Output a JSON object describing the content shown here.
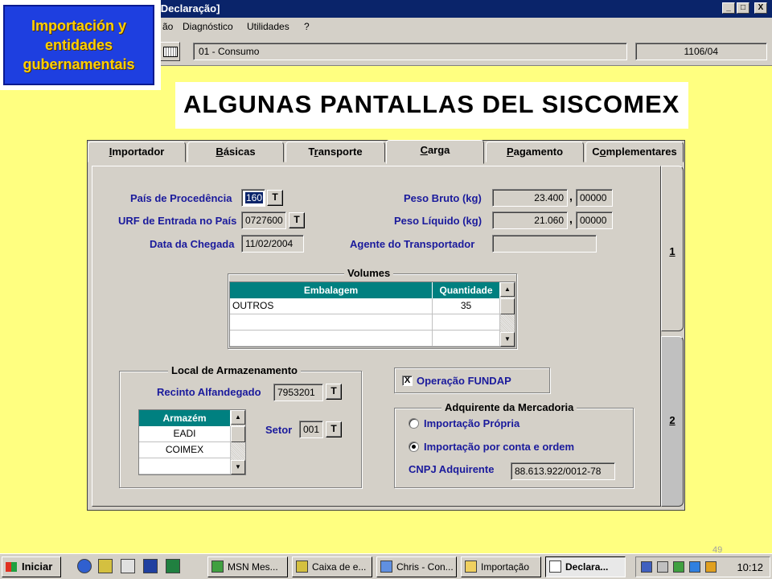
{
  "window": {
    "title": "Declaração de Importação - [Declaração]",
    "minimize": "_",
    "maximize": "□",
    "close": "X"
  },
  "menu": {
    "items": [
      "ão",
      "Diagnóstico",
      "Utilidades",
      "?"
    ]
  },
  "toolbar": {
    "type_value": "01 - Consumo",
    "number_value": "1106/04"
  },
  "logo": {
    "line1": "Importación y",
    "line2": "entidades",
    "line3": "gubernamentais"
  },
  "heading": "ALGUNAS PANTALLAS DEL SISCOMEX",
  "tabs": [
    "Importador",
    "Básicas",
    "Transporte",
    "Carga",
    "Pagamento",
    "Complementares"
  ],
  "tab_access_keys": [
    "I",
    "B",
    "r",
    "C",
    "P",
    "o"
  ],
  "active_tab": "Carga",
  "side_tabs": [
    "1",
    "2"
  ],
  "carga": {
    "pais_procedencia_label": "País de Procedência",
    "pais_procedencia_value": "160",
    "urf_entrada_label": "URF de Entrada no País",
    "urf_entrada_value": "0727600",
    "data_chegada_label": "Data da Chegada",
    "data_chegada_value": "11/02/2004",
    "peso_bruto_label": "Peso Bruto (kg)",
    "peso_bruto_int": "23.400",
    "peso_bruto_dec": "00000",
    "peso_liquido_label": "Peso Líquido (kg)",
    "peso_liquido_int": "21.060",
    "peso_liquido_dec": "00000",
    "agente_label": "Agente do Transportador",
    "agente_value": "",
    "t_button": "T",
    "comma": ","
  },
  "volumes": {
    "title": "Volumes",
    "columns": [
      "Embalagem",
      "Quantidade"
    ],
    "rows": [
      [
        "OUTROS",
        "35"
      ],
      [
        "",
        ""
      ],
      [
        "",
        ""
      ]
    ]
  },
  "armazenamento": {
    "title": "Local de Armazenamento",
    "recinto_label": "Recinto Alfandegado",
    "recinto_value": "7953201",
    "setor_label": "Setor",
    "setor_value": "001",
    "armazem_header": "Armazém",
    "armazem_rows": [
      "EADI",
      "COIMEX",
      ""
    ]
  },
  "fundap": {
    "label": "Operação FUNDAP",
    "checked_mark": "X"
  },
  "adquirente": {
    "title": "Adquirente da Mercadoria",
    "option1": "Importação Própria",
    "option2": "Importação por conta e ordem",
    "selected": "option2",
    "cnpj_label": "CNPJ Adquirente",
    "cnpj_value": "88.613.922/0012-78"
  },
  "page_number": "49",
  "taskbar": {
    "start_label": "Iniciar",
    "tasks": [
      "MSN Mes...",
      "Caixa de e...",
      "Chris - Con...",
      "Importação",
      "Declara..."
    ],
    "active_task": "Declara...",
    "clock": "10:12"
  },
  "colors": {
    "slide_background": "#FFFF80",
    "title_bar": "#0A246A",
    "grid_header": "#008080",
    "label_blue": "#1A1A9C",
    "logo_blue": "#1E3FE0",
    "logo_text": "#FFD000"
  }
}
